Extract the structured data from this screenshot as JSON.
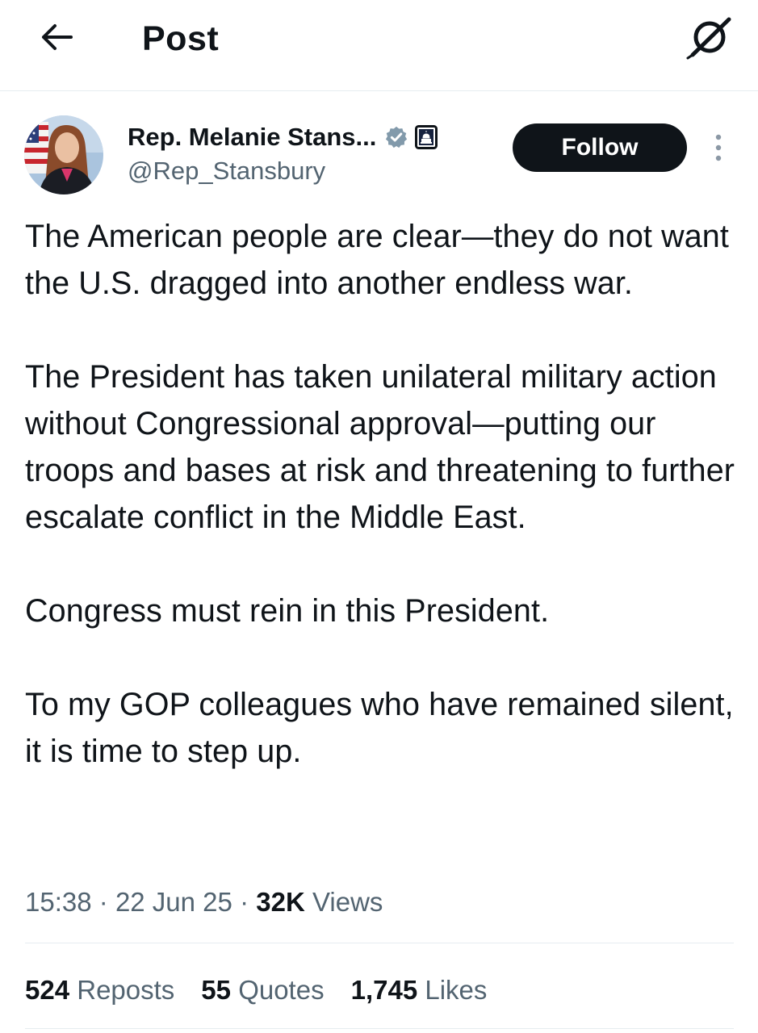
{
  "header": {
    "title": "Post",
    "back_icon": "arrow-left-icon",
    "grok_icon": "grok-icon"
  },
  "author": {
    "display_name": "Rep. Melanie Stans...",
    "handle": "@Rep_Stansbury",
    "follow_label": "Follow",
    "verified_color": "#829aab",
    "badges": [
      "verified-badge-icon",
      "capitol-affiliation-icon"
    ]
  },
  "post": {
    "paragraphs": [
      "The American people are clear—they do not want the U.S. dragged into another endless war.",
      "The President has taken unilateral military action without Congressional approval—putting our troops and bases at risk and threatening to further escalate conflict in the Middle East.",
      "Congress must rein in this President.",
      "To my GOP colleagues who have remained silent, it is time to step up."
    ],
    "time": "15:38",
    "date": "22 Jun 25",
    "views_count": "32K",
    "views_label": "Views"
  },
  "stats": [
    {
      "count": "524",
      "label": "Reposts"
    },
    {
      "count": "55",
      "label": "Quotes"
    },
    {
      "count": "1,745",
      "label": "Likes"
    }
  ],
  "colors": {
    "text": "#0f1419",
    "secondary": "#536471",
    "divider": "#e6ecf0",
    "follow_bg": "#0f1419"
  }
}
